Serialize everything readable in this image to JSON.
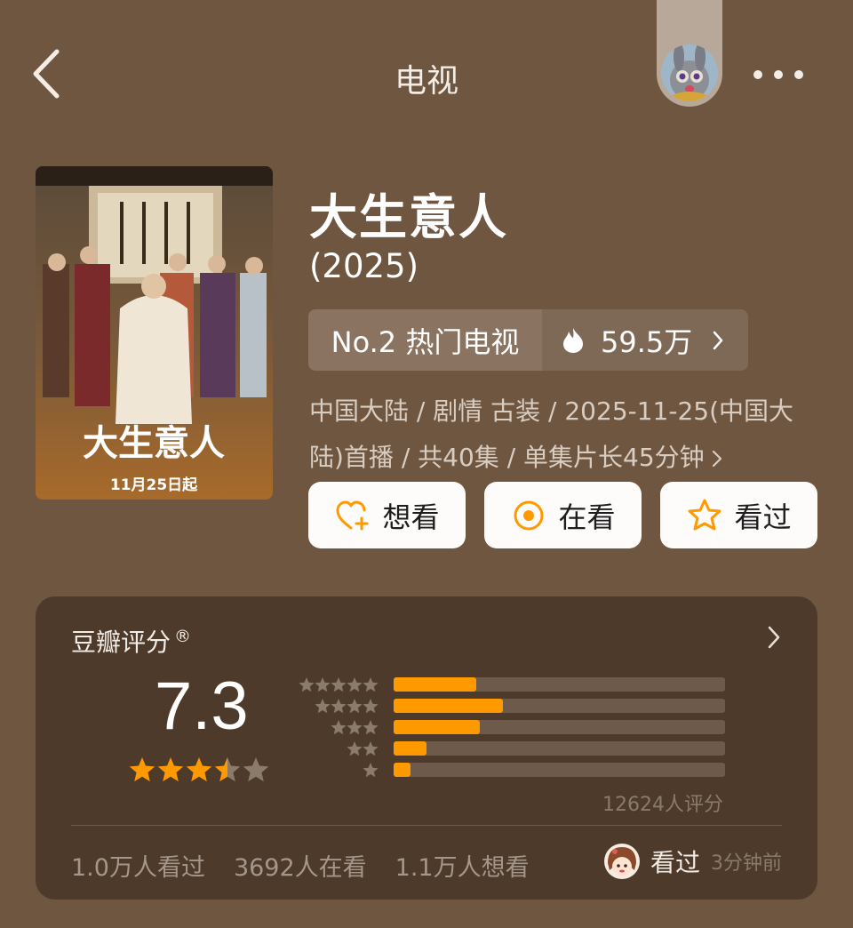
{
  "header": {
    "title": "电视"
  },
  "poster": {
    "title_art": "大生意人",
    "date_tag": "11月25日起"
  },
  "show": {
    "title": "大生意人",
    "year": "(2025)"
  },
  "rank": {
    "label": "No.2 热门电视",
    "heat": "59.5万"
  },
  "meta": {
    "line": "中国大陆 / 剧情 古装 / 2025-11-25(中国大陆)首播 / 共40集 / 单集片长45分钟"
  },
  "actions": {
    "want": "想看",
    "doing": "在看",
    "done": "看过"
  },
  "rating": {
    "label": "豆瓣评分",
    "registered": "®",
    "score": "7.3",
    "stars_value": 3.5,
    "distribution": [
      {
        "stars": 5,
        "fraction": 0.25
      },
      {
        "stars": 4,
        "fraction": 0.33
      },
      {
        "stars": 3,
        "fraction": 0.26
      },
      {
        "stars": 2,
        "fraction": 0.1
      },
      {
        "stars": 1,
        "fraction": 0.05
      }
    ],
    "count": "12624人评分"
  },
  "stats": {
    "watched": "1.0万人看过",
    "watching": "3692人在看",
    "want": "1.1万人想看"
  },
  "recent": {
    "action": "看过",
    "time": "3分钟前"
  },
  "colors": {
    "background": "#6e5641",
    "card": "#4d3a2a",
    "accent": "#ff9900",
    "button": "#fefcfa"
  }
}
